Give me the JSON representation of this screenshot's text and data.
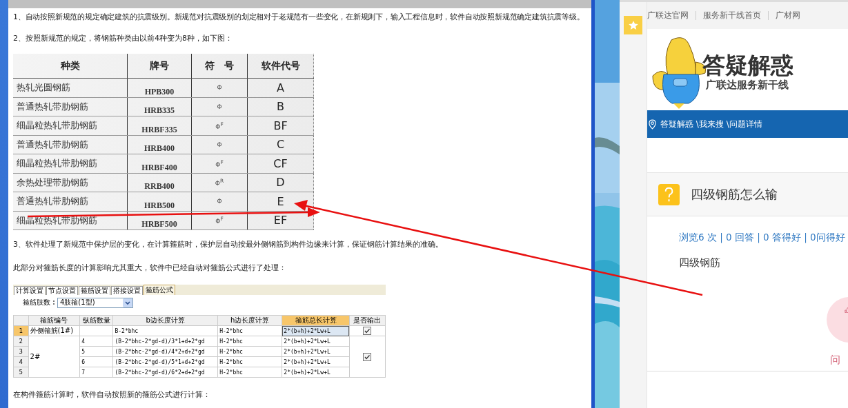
{
  "document": {
    "intro_1": "1、自动按照新规范的规定确定建筑的抗震级别。新规范对抗震级别的划定相对于老规范有一些变化，在新规则下，输入工程信息时，软件自动按照新规范确定建筑抗震等级。",
    "intro_2": "2、按照新规范的规定，将钢筋种类由以前4种变为8种，如下图：",
    "rebar_table": {
      "columns": [
        "种类",
        "牌号",
        "符　号",
        "软件代号"
      ],
      "rows": [
        {
          "kind": "热轧光圆钢筋",
          "grade": "HPB300",
          "symbol": "Φ",
          "code": "A"
        },
        {
          "kind": "普通热轧带肋钢筋",
          "grade": "HRB335",
          "symbol": "Φ",
          "code": "B"
        },
        {
          "kind": "细晶粒热轧带肋钢筋",
          "grade": "HRBF335",
          "symbol": "Φ$^{F}$",
          "code": "BF"
        },
        {
          "kind": "普通热轧带肋钢筋",
          "grade": "HRB400",
          "symbol": "Φ",
          "code": "C"
        },
        {
          "kind": "细晶粒热轧带肋钢筋",
          "grade": "HRBF400",
          "symbol": "Φ$^{F}$",
          "code": "CF"
        },
        {
          "kind": "余热处理带肋钢筋",
          "grade": "RRB400",
          "symbol": "Φ$^{R}$",
          "code": "D"
        },
        {
          "kind": "普通热轧带肋钢筋",
          "grade": "HRB500",
          "symbol": "Φ",
          "code": "E"
        },
        {
          "kind": "细晶粒热轧带肋钢筋",
          "grade": "HRBF500",
          "symbol": "Φ$^{F}$",
          "code": "EF"
        }
      ]
    },
    "note_3": "3、软件处理了新规范中保护层的变化，在计算箍筋时，保护层自动按最外侧钢筋到构件边缘来计算，保证钢筋计算结果的准确。",
    "note_4": "此部分对箍筋长度的计算影响尤其重大，软件中已经自动对箍筋公式进行了处理：",
    "settings_screenshot": {
      "tabs": [
        {
          "label": "计算设置",
          "selected": false
        },
        {
          "label": "节点设置",
          "selected": false
        },
        {
          "label": "箍筋设置",
          "selected": false
        },
        {
          "label": "搭接设置",
          "selected": false
        },
        {
          "label": "箍筋公式",
          "selected": true
        }
      ],
      "stirrup_limbs": {
        "label": "箍筋肢数",
        "value": "4肢箍(1型)"
      },
      "grid": {
        "columns": [
          {
            "label": "箍筋编号",
            "selected": false
          },
          {
            "label": "纵筋数量",
            "selected": false
          },
          {
            "label": "b边长度计算",
            "selected": false
          },
          {
            "label": "h边长度计算",
            "selected": false
          },
          {
            "label": "箍筋总长计算",
            "selected": true
          },
          {
            "label": "是否输出",
            "selected": false
          }
        ],
        "groups": [
          {
            "name": "外侧箍筋(1#)",
            "output": true,
            "rows": [
              {
                "number": "1",
                "selected": true,
                "b_length": "B-2*bhc",
                "h_length": "H-2*bhc",
                "total_length": "2*(b+h)+2*Lw+L"
              }
            ]
          },
          {
            "name": "2#",
            "output": true,
            "rows": [
              {
                "number": "2",
                "selected": false,
                "bar_count": "4",
                "b_length": "(B-2*bhc-2*gd-d)/3*1+d+2*gd",
                "h_length": "H-2*bhc",
                "total_length": "2*(b+h)+2*Lw+L"
              },
              {
                "number": "3",
                "selected": false,
                "bar_count": "5",
                "b_length": "(B-2*bhc-2*gd-d)/4*2+d+2*gd",
                "h_length": "H-2*bhc",
                "total_length": "2*(b+h)+2*Lw+L"
              },
              {
                "number": "4",
                "selected": false,
                "bar_count": "6",
                "b_length": "(B-2*bhc-2*gd-d)/5*1+d+2*gd",
                "h_length": "H-2*bhc",
                "total_length": "2*(b+h)+2*Lw+L"
              },
              {
                "number": "5",
                "selected": false,
                "bar_count": "7",
                "b_length": "(B-2*bhc-2*gd-d)/6*2+d+2*gd",
                "h_length": "H-2*bhc",
                "total_length": "2*(b+h)+2*Lw+L"
              }
            ]
          }
        ]
      }
    },
    "closing": "在构件箍筋计算时，软件自动按照新的箍筋公式进行计算："
  },
  "browser": {
    "nav_links": [
      "广联达官网",
      "服务新干线首页",
      "广材网"
    ],
    "logo": {
      "title": "答疑解惑",
      "subtitle": "广联达服务新干线"
    },
    "breadcrumb": "答疑解惑 \\我来搜 \\问题详情",
    "question": {
      "title": "四级钢筋怎么输",
      "stats": "浏览6 次 | 0 回答 | 0 答得好 | 0问得好",
      "body": "四级钢筋"
    },
    "like_label": "问"
  }
}
